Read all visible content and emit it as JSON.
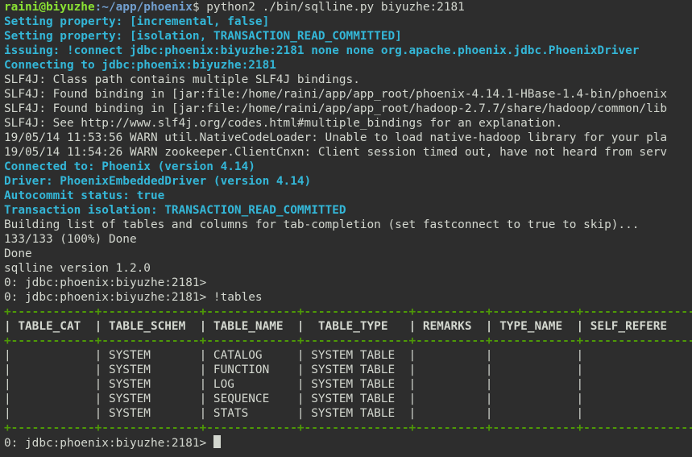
{
  "prompt": {
    "user_host": "raini@biyuzhe",
    "path": ":~/app/phoenix",
    "symbol": "$ ",
    "command": "python2 ./bin/sqlline.py biyuzhe:2181"
  },
  "lines": [
    "Setting property: [incremental, false]",
    "Setting property: [isolation, TRANSACTION_READ_COMMITTED]",
    "issuing: !connect jdbc:phoenix:biyuzhe:2181 none none org.apache.phoenix.jdbc.PhoenixDriver",
    "Connecting to jdbc:phoenix:biyuzhe:2181",
    "SLF4J: Class path contains multiple SLF4J bindings.",
    "SLF4J: Found binding in [jar:file:/home/raini/app/app_root/phoenix-4.14.1-HBase-1.4-bin/phoenix",
    "SLF4J: Found binding in [jar:file:/home/raini/app/app_root/hadoop-2.7.7/share/hadoop/common/lib",
    "SLF4J: See http://www.slf4j.org/codes.html#multiple_bindings for an explanation.",
    "19/05/14 11:53:56 WARN util.NativeCodeLoader: Unable to load native-hadoop library for your pla",
    "19/05/14 11:54:26 WARN zookeeper.ClientCnxn: Client session timed out, have not heard from serv",
    "Connected to: Phoenix (version 4.14)",
    "Driver: PhoenixEmbeddedDriver (version 4.14)",
    "Autocommit status: true",
    "Transaction isolation: TRANSACTION_READ_COMMITTED",
    "Building list of tables and columns for tab-completion (set fastconnect to true to skip)...",
    "133/133 (100%) Done",
    "Done",
    "sqlline version 1.2.0",
    "0: jdbc:phoenix:biyuzhe:2181>",
    "0: jdbc:phoenix:biyuzhe:2181> !tables"
  ],
  "table": {
    "border": "+------------+--------------+-------------+---------------+----------+------------+----------------",
    "header": "| TABLE_CAT  | TABLE_SCHEM  | TABLE_NAME  |  TABLE_TYPE   | REMARKS  | TYPE_NAME  | SELF_REFERE",
    "rows": [
      "|            | SYSTEM       | CATALOG     | SYSTEM TABLE  |          |            |",
      "|            | SYSTEM       | FUNCTION    | SYSTEM TABLE  |          |            |",
      "|            | SYSTEM       | LOG         | SYSTEM TABLE  |          |            |",
      "|            | SYSTEM       | SEQUENCE    | SYSTEM TABLE  |          |            |",
      "|            | SYSTEM       | STATS       | SYSTEM TABLE  |          |            |"
    ]
  },
  "final_prompt": "0: jdbc:phoenix:biyuzhe:2181> ",
  "colors": {
    "background": "#2d2d2d",
    "prompt_green": "#8ae234",
    "prompt_blue": "#729fcf",
    "info_cyan": "#34b7d8",
    "text": "#d3d7cf",
    "table_border": "#4e9a06"
  }
}
